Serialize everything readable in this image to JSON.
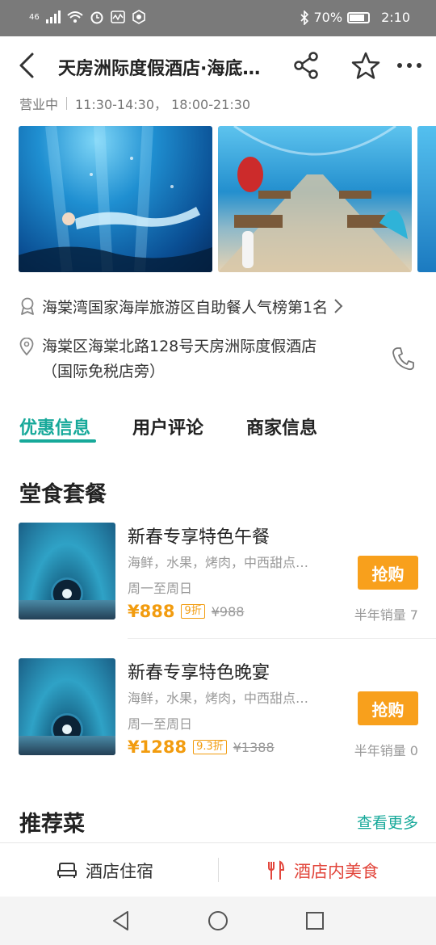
{
  "status_bar": {
    "network": "46",
    "battery": "70%",
    "time": "2:10"
  },
  "header": {
    "title": "天房洲际度假酒店·海底…",
    "icons": [
      "back-icon",
      "share-icon",
      "star-icon",
      "more-icon"
    ]
  },
  "hours": {
    "status": "营业中",
    "times": "11:30-14:30， 18:00-21:30"
  },
  "ranking": {
    "text": "海棠湾国家海岸旅游区自助餐人气榜第1名"
  },
  "address": {
    "line1": "海棠区海棠北路128号天房洲际度假酒店",
    "line2": "（国际免税店旁）"
  },
  "tabs": [
    {
      "label": "优惠信息",
      "active": true
    },
    {
      "label": "用户评论",
      "active": false
    },
    {
      "label": "商家信息",
      "active": false
    }
  ],
  "dine_in": {
    "title": "堂食套餐",
    "deals": [
      {
        "name": "新春专享特色午餐",
        "desc": "海鲜，水果，烤肉，中西甜点…",
        "days": "周一至周日",
        "price": "¥888",
        "discount": "9折",
        "original": "¥988",
        "buy_label": "抢购",
        "sold": "半年销量 7"
      },
      {
        "name": "新春专享特色晚宴",
        "desc": "海鲜，水果，烤肉，中西甜点…",
        "days": "周一至周日",
        "price": "¥1288",
        "discount": "9.3折",
        "original": "¥1388",
        "buy_label": "抢购",
        "sold": "半年销量 0"
      }
    ]
  },
  "recommended": {
    "title": "推荐菜",
    "more": "查看更多"
  },
  "bottom_bar": {
    "hotel": "酒店住宿",
    "dining": "酒店内美食"
  },
  "colors": {
    "accent": "#17a99a",
    "price": "#f29c0f",
    "buy_button": "#f8a01c",
    "dining_active": "#e2463c"
  }
}
